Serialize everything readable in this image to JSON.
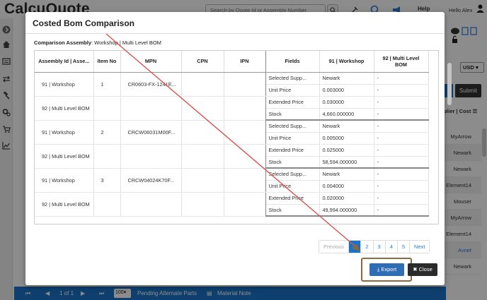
{
  "app": {
    "logo": "CalcuQuote",
    "search_placeholder": "Search by Quote Id or Assembly Number",
    "help_label": "Help",
    "user_greeting": "Hello Alex"
  },
  "background": {
    "currency": "USD",
    "submit_label": "Submit",
    "supplier_header": "pplier | Cost",
    "suppliers": [
      "MyArrow",
      "Newark",
      "Newark",
      "Element14",
      "Mouser",
      "MyArrow",
      "Element14",
      "Avnet",
      "Newark"
    ],
    "bottom_bar": {
      "page_info": "1 of 1",
      "page_size": "100",
      "pending_label": "Pending Alternate Parts",
      "material_note_label": "Material Note"
    }
  },
  "modal": {
    "title": "Costed Bom Comparison",
    "comparison_label": "Comparison Assembly",
    "comparison_value": ": Workshop | Multi Level BOM",
    "columns": [
      "Assembly Id | Asse...",
      "Item No",
      "MPN",
      "CPN",
      "IPN",
      "Fields",
      "91 | Workshop",
      "92 | Multi Level BOM"
    ],
    "groups": [
      {
        "item_no": "1",
        "mpn": "CR0603-FX-1241E...",
        "assemblies": [
          "91 | Workshop",
          "92 | Multi Level BOM"
        ],
        "fields": [
          {
            "name": "Selected Supp...",
            "v91": "Newark",
            "v92": "-"
          },
          {
            "name": "Unit Price",
            "v91": "0.003000",
            "v92": "-"
          },
          {
            "name": "Extended Price",
            "v91": "0.030000",
            "v92": "-"
          },
          {
            "name": "Stock",
            "v91": "4,660.000000",
            "v92": "-"
          }
        ]
      },
      {
        "item_no": "2",
        "mpn": "CRCW06031M00F...",
        "assemblies": [
          "91 | Workshop",
          "92 | Multi Level BOM"
        ],
        "fields": [
          {
            "name": "Selected Supp...",
            "v91": "Newark",
            "v92": "-"
          },
          {
            "name": "Unit Price",
            "v91": "0.005000",
            "v92": "-"
          },
          {
            "name": "Extended Price",
            "v91": "0.025000",
            "v92": "-"
          },
          {
            "name": "Stock",
            "v91": "58,594.000000",
            "v92": "-"
          }
        ]
      },
      {
        "item_no": "3",
        "mpn": "CRCW04024K70F...",
        "assemblies": [
          "91 | Workshop",
          "92 | Multi Level BOM"
        ],
        "fields": [
          {
            "name": "Selected Supp...",
            "v91": "Newark",
            "v92": "-"
          },
          {
            "name": "Unit Price",
            "v91": "0.004000",
            "v92": "-"
          },
          {
            "name": "Extended Price",
            "v91": "0.020000",
            "v92": "-"
          },
          {
            "name": "Stock",
            "v91": "49,994.000000",
            "v92": "-"
          }
        ]
      }
    ],
    "pagination": {
      "previous": "Previous",
      "pages": [
        "1",
        "2",
        "3",
        "4",
        "5"
      ],
      "active_page": "1",
      "next": "Next"
    },
    "export_label": "Export",
    "close_label": "Close"
  },
  "colors": {
    "primary": "#1a73c8",
    "annotation_arrow": "#d9534f",
    "highlight_box": "#8a6a3c"
  }
}
